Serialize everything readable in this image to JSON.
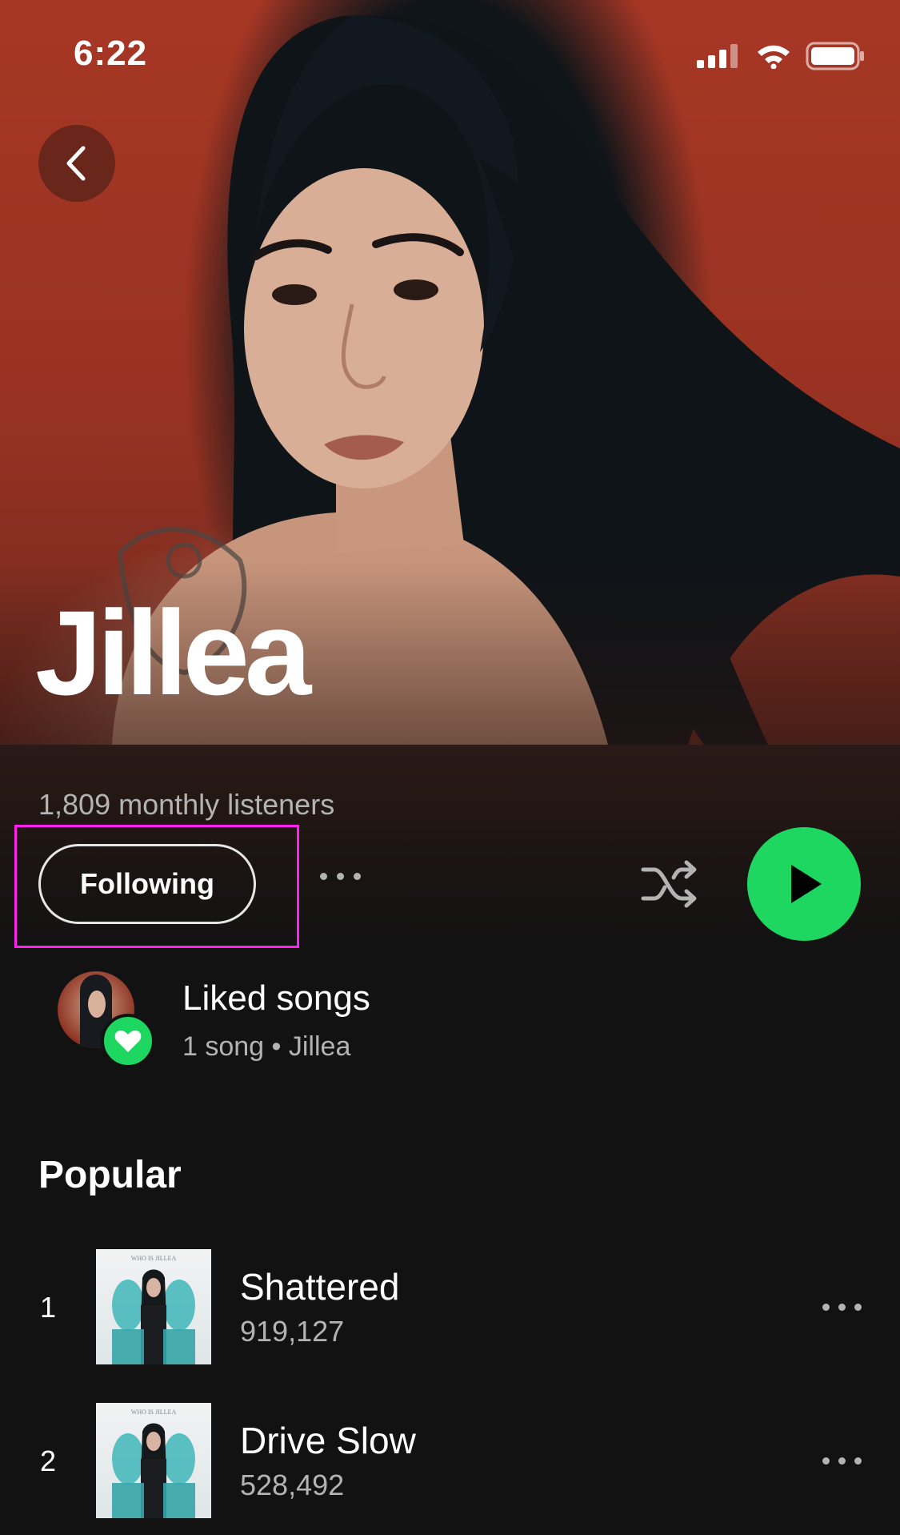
{
  "status_bar": {
    "time": "6:22"
  },
  "artist": {
    "name": "Jillea",
    "monthly_listeners": "1,809 monthly listeners"
  },
  "actions": {
    "follow_label": "Following"
  },
  "liked": {
    "title": "Liked songs",
    "subtitle": "1 song • Jillea"
  },
  "popular": {
    "title": "Popular",
    "tracks": [
      {
        "rank": "1",
        "title": "Shattered",
        "plays": "919,127"
      },
      {
        "rank": "2",
        "title": "Drive Slow",
        "plays": "528,492"
      }
    ]
  },
  "album_art_text": "WHO IS JILLEA",
  "colors": {
    "accent": "#1ed760",
    "background": "#121212",
    "hero": "#a73725",
    "highlight": "#ff22ee"
  },
  "icons": [
    "back-icon",
    "signal-icon",
    "wifi-icon",
    "battery-icon",
    "more-icon",
    "shuffle-icon",
    "play-icon",
    "heart-icon"
  ]
}
